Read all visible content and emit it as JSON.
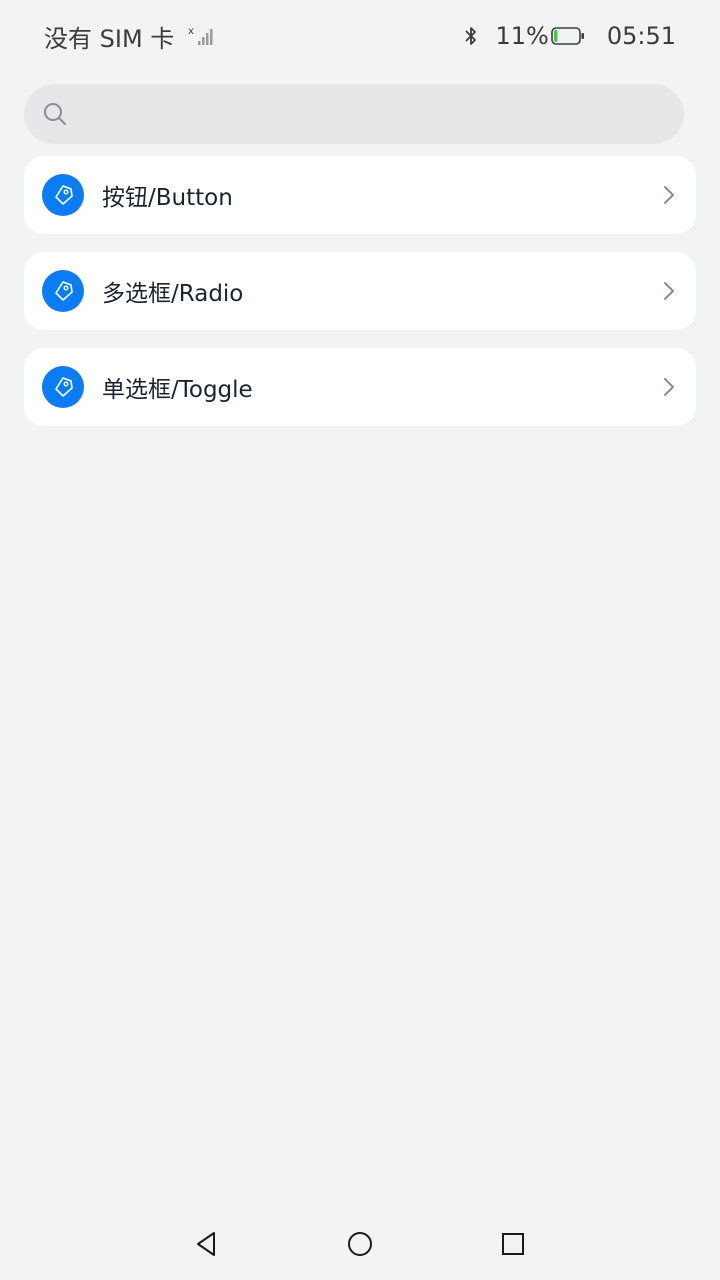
{
  "status_bar": {
    "carrier": "没有 SIM 卡",
    "battery": "11%",
    "time": "05:51"
  },
  "search": {
    "placeholder": ""
  },
  "items": [
    {
      "label": "按钮/Button",
      "icon": "tag-icon"
    },
    {
      "label": "多选框/Radio",
      "icon": "tag-icon"
    },
    {
      "label": "单选框/Toggle",
      "icon": "tag-icon"
    }
  ],
  "colors": {
    "accent": "#0a7cf5",
    "background": "#f1f3f5",
    "card": "#ffffff",
    "search_bg": "#e5e7e9",
    "battery_level": "#3bd13b"
  },
  "nav": {
    "back_icon": "back-triangle-icon",
    "home_icon": "home-circle-icon",
    "recent_icon": "recent-square-icon"
  }
}
